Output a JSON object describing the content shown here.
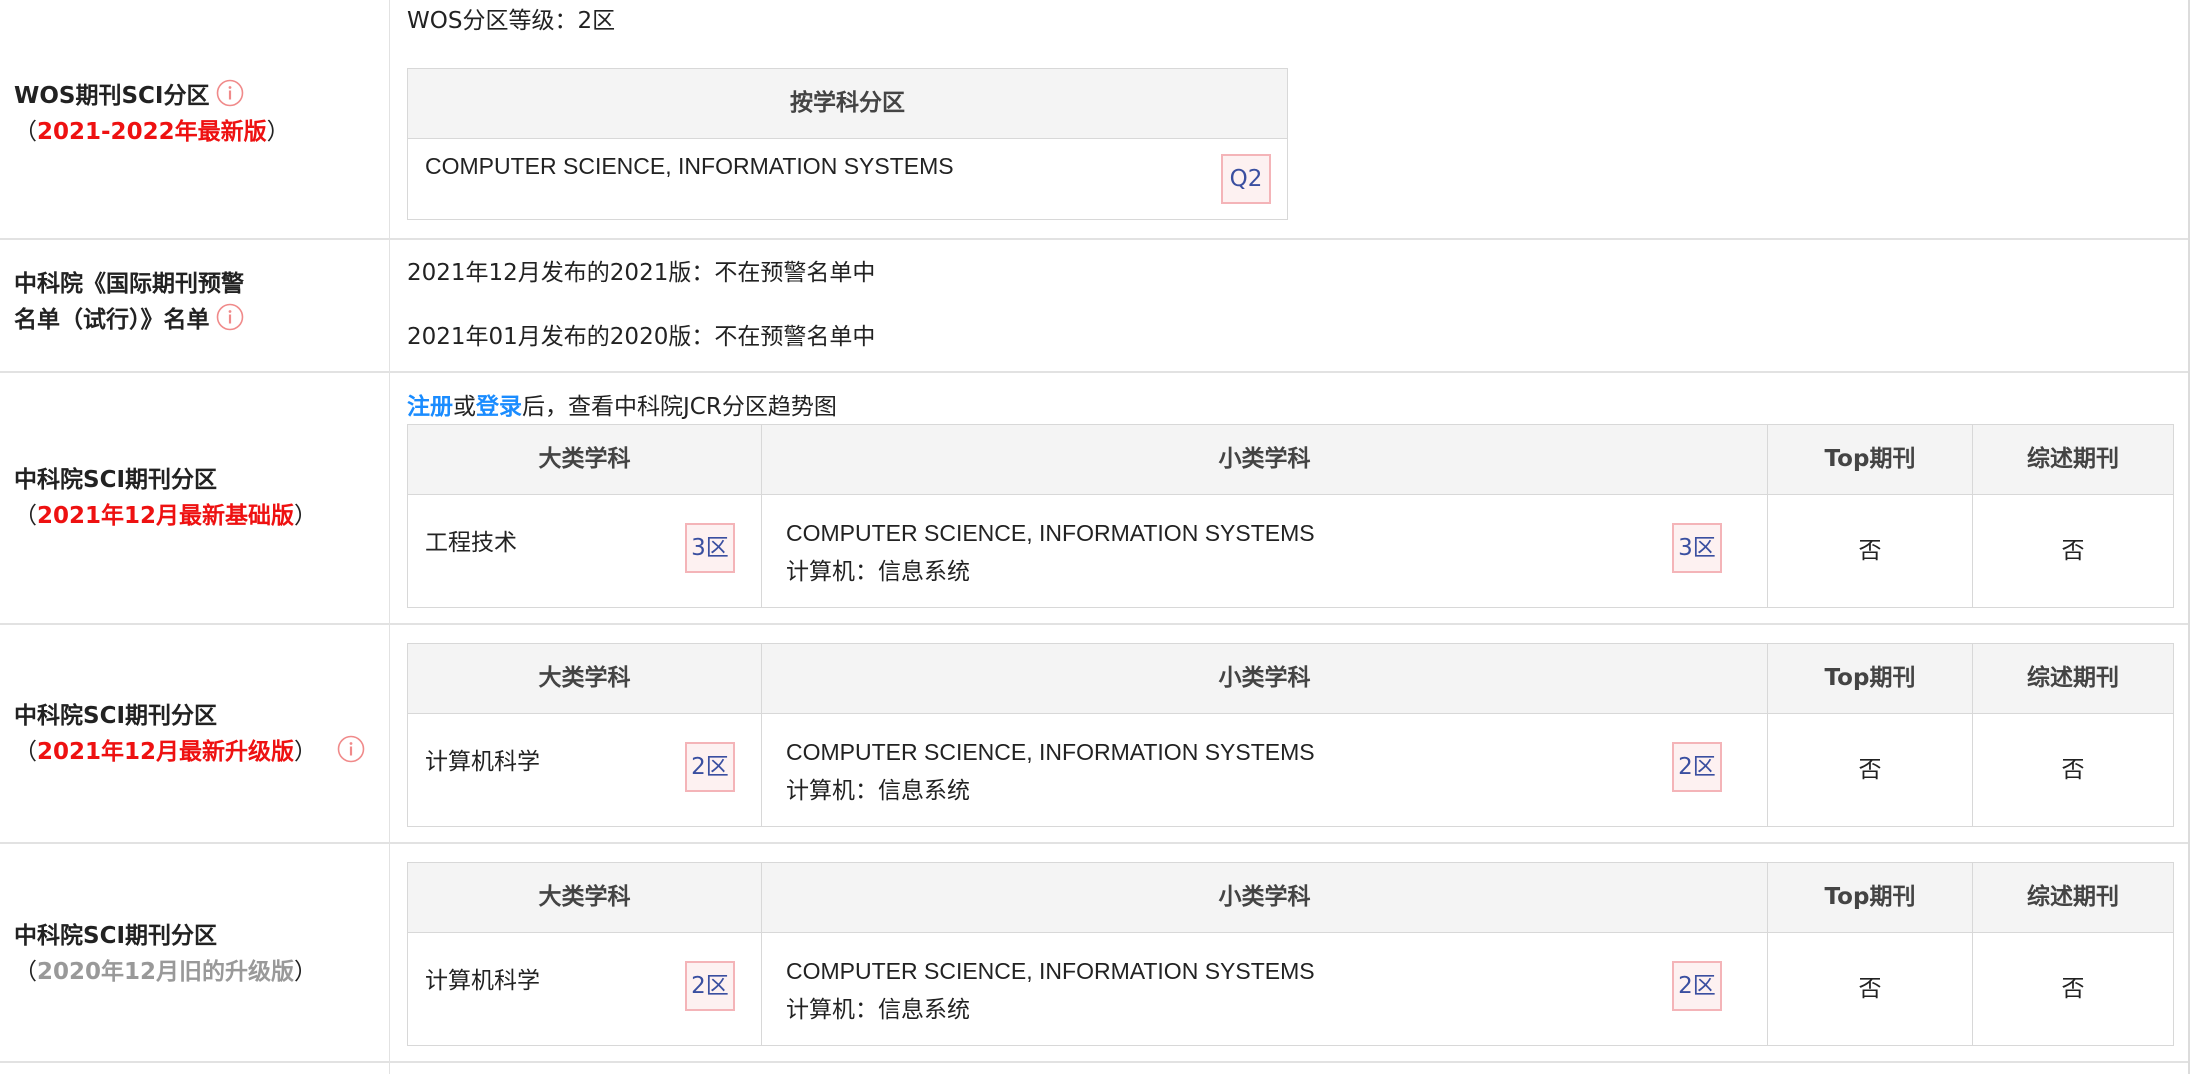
{
  "wos": {
    "label_title": "WOS期刊SCI分区",
    "label_open": "（",
    "label_version": "2021-2022年最新版",
    "label_close": "）",
    "grade_text": "WOS分区等级：2区",
    "table_header": "按学科分区",
    "subject": "COMPUTER SCIENCE, INFORMATION SYSTEMS",
    "quartile": "Q2"
  },
  "warning": {
    "label_line1": "中科院《国际期刊预警",
    "label_line2": "名单（试行）》名单",
    "line1": "2021年12月发布的2021版：不在预警名单中",
    "line2": "2021年01月发布的2020版：不在预警名单中"
  },
  "register_note": {
    "register": "注册",
    "or": "或",
    "login": "登录",
    "rest": "后，查看中科院JCR分区趋势图"
  },
  "cas_sections": [
    {
      "label_title": "中科院SCI期刊分区",
      "label_open": "（",
      "label_version": "2021年12月最新基础版",
      "label_close": "）",
      "headers": {
        "big": "大类学科",
        "small": "小类学科",
        "top": "Top期刊",
        "review": "综述期刊"
      },
      "big_category": "工程技术",
      "big_zone": "3区",
      "small_en": "COMPUTER SCIENCE, INFORMATION SYSTEMS",
      "small_cn": "计算机：信息系统",
      "small_zone": "3区",
      "top": "否",
      "review": "否"
    },
    {
      "label_title": "中科院SCI期刊分区",
      "label_open": "（",
      "label_version": "2021年12月最新升级版",
      "label_close": "）",
      "headers": {
        "big": "大类学科",
        "small": "小类学科",
        "top": "Top期刊",
        "review": "综述期刊"
      },
      "big_category": "计算机科学",
      "big_zone": "2区",
      "small_en": "COMPUTER SCIENCE, INFORMATION SYSTEMS",
      "small_cn": "计算机：信息系统",
      "small_zone": "2区",
      "top": "否",
      "review": "否"
    },
    {
      "label_title": "中科院SCI期刊分区",
      "label_open": "（",
      "label_version": "2020年12月旧的升级版",
      "label_close": "）",
      "headers": {
        "big": "大类学科",
        "small": "小类学科",
        "top": "Top期刊",
        "review": "综述期刊"
      },
      "big_category": "计算机科学",
      "big_zone": "2区",
      "small_en": "COMPUTER SCIENCE, INFORMATION SYSTEMS",
      "small_cn": "计算机：信息系统",
      "small_zone": "2区",
      "top": "否",
      "review": "否"
    }
  ],
  "colors": {
    "accent_red": "#ee1111",
    "link_blue": "#1a8cff",
    "old_gray": "#999999",
    "badge_border": "#f4b4b8",
    "badge_text": "#3a4fa0"
  },
  "icons": [
    "info-icon"
  ]
}
